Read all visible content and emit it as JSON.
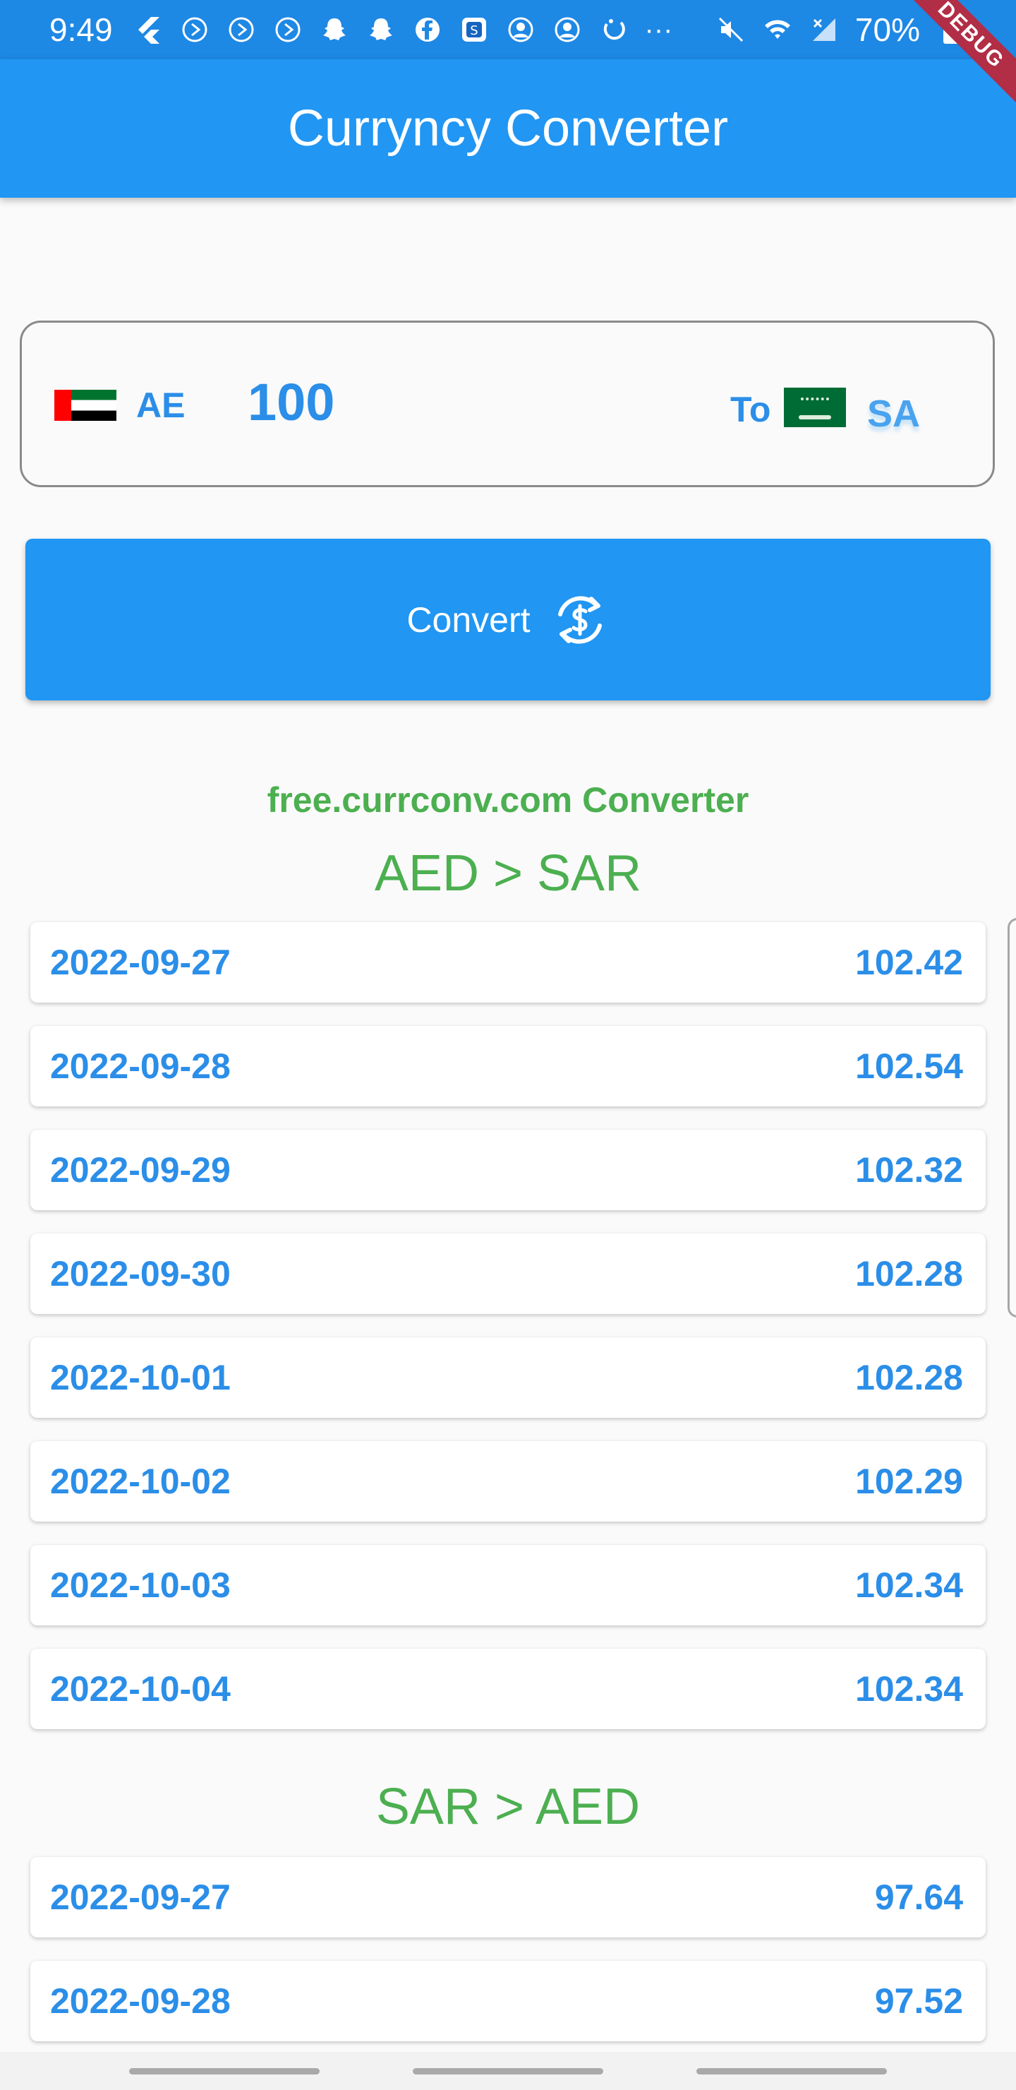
{
  "status_bar": {
    "time": "9:49",
    "more": "···",
    "battery": "70%"
  },
  "debug_banner": "DEBUG",
  "app_bar": {
    "title": "Currуncy Converter"
  },
  "converter": {
    "from_code": "AE",
    "amount": "100",
    "to_label": "To",
    "to_code": "SA",
    "convert_label": "Convert"
  },
  "source_label": "free.currconv.com Converter",
  "sections": [
    {
      "title": "AED > SAR",
      "rows": [
        {
          "date": "2022-09-27",
          "value": "102.42"
        },
        {
          "date": "2022-09-28",
          "value": "102.54"
        },
        {
          "date": "2022-09-29",
          "value": "102.32"
        },
        {
          "date": "2022-09-30",
          "value": "102.28"
        },
        {
          "date": "2022-10-01",
          "value": "102.28"
        },
        {
          "date": "2022-10-02",
          "value": "102.29"
        },
        {
          "date": "2022-10-03",
          "value": "102.34"
        },
        {
          "date": "2022-10-04",
          "value": "102.34"
        }
      ]
    },
    {
      "title": "SAR > AED",
      "rows": [
        {
          "date": "2022-09-27",
          "value": "97.64"
        },
        {
          "date": "2022-09-28",
          "value": "97.52"
        }
      ]
    }
  ],
  "colors": {
    "primary": "#2196F3",
    "status_bar": "#1E88E5",
    "accent_text": "#2B8EE8",
    "section_green": "#4CAF50",
    "debug_red": "#B12E46"
  },
  "icons": {
    "convert": "currency-exchange-icon",
    "flag_from": "uae-flag-icon",
    "flag_to": "saudi-flag-icon"
  }
}
